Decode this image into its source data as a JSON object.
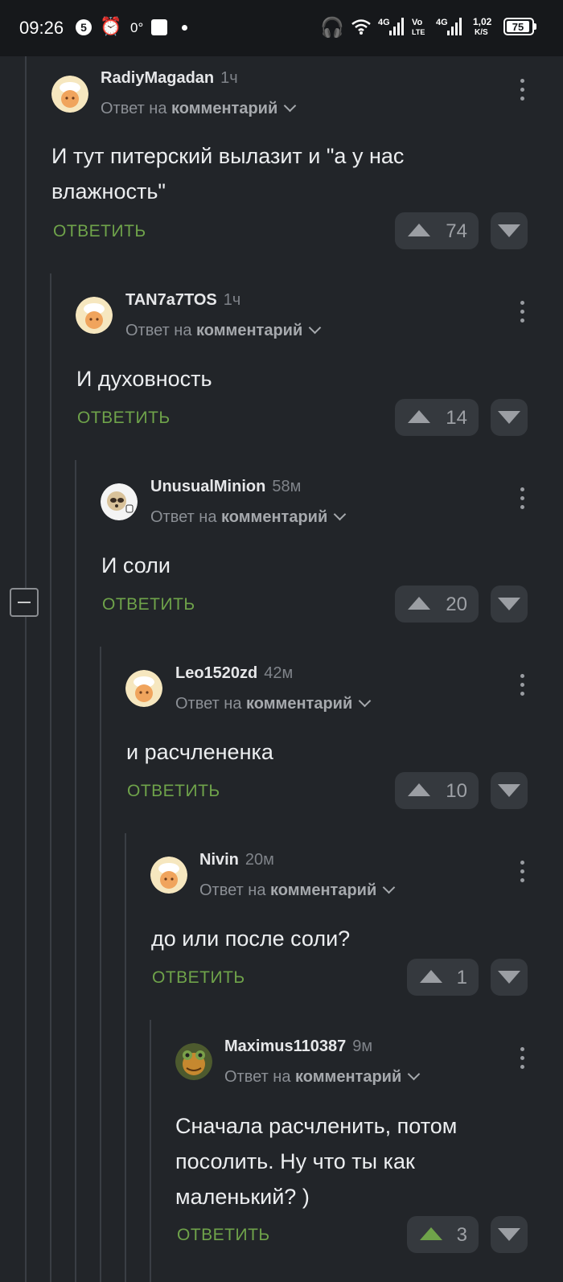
{
  "status_bar": {
    "time": "09:26",
    "notif_badge": "5",
    "temperature": "0°",
    "network_4g_a": "4G",
    "network_vo": "Vo",
    "network_lte": "LTE",
    "network_4g_b": "4G",
    "speed_value": "1,02",
    "speed_unit": "K/S",
    "battery": "75"
  },
  "comments": [
    {
      "author": "RadiyMagadan",
      "age": "1ч",
      "reply_prefix": "Ответ на",
      "reply_target": "комментарий",
      "text": "И тут питерский вылазит и \"а у нас влажность\"",
      "reply_label": "ОТВЕТИТЬ",
      "rating": "74",
      "upvoted": false,
      "avatar": "cook-avatar"
    },
    {
      "author": "TAN7a7TOS",
      "age": "1ч",
      "reply_prefix": "Ответ на",
      "reply_target": "комментарий",
      "text": "И духовность",
      "reply_label": "ОТВЕТИТЬ",
      "rating": "14",
      "upvoted": false,
      "avatar": "cook-avatar"
    },
    {
      "author": "UnusualMinion",
      "age": "58м",
      "reply_prefix": "Ответ на",
      "reply_target": "комментарий",
      "text": "И соли",
      "reply_label": "ОТВЕТИТЬ",
      "rating": "20",
      "upvoted": false,
      "avatar": "sloth-avatar"
    },
    {
      "author": "Leo1520zd",
      "age": "42м",
      "reply_prefix": "Ответ на",
      "reply_target": "комментарий",
      "text": "и расчлененка",
      "reply_label": "ОТВЕТИТЬ",
      "rating": "10",
      "upvoted": false,
      "avatar": "cook-avatar"
    },
    {
      "author": "Nivin",
      "age": "20м",
      "reply_prefix": "Ответ на",
      "reply_target": "комментарий",
      "text": "до или после соли?",
      "reply_label": "ОТВЕТИТЬ",
      "rating": "1",
      "upvoted": false,
      "avatar": "cook-avatar"
    },
    {
      "author": "Maximus110387",
      "age": "9м",
      "reply_prefix": "Ответ на",
      "reply_target": "комментарий",
      "text": "Сначала расчленить, потом посолить. Ну что ты как маленький? )",
      "reply_label": "ОТВЕТИТЬ",
      "rating": "3",
      "upvoted": true,
      "avatar": "frog-avatar"
    }
  ],
  "colors": {
    "background": "#222529",
    "accent_green": "#6fa34a",
    "muted": "#8b8f95"
  }
}
